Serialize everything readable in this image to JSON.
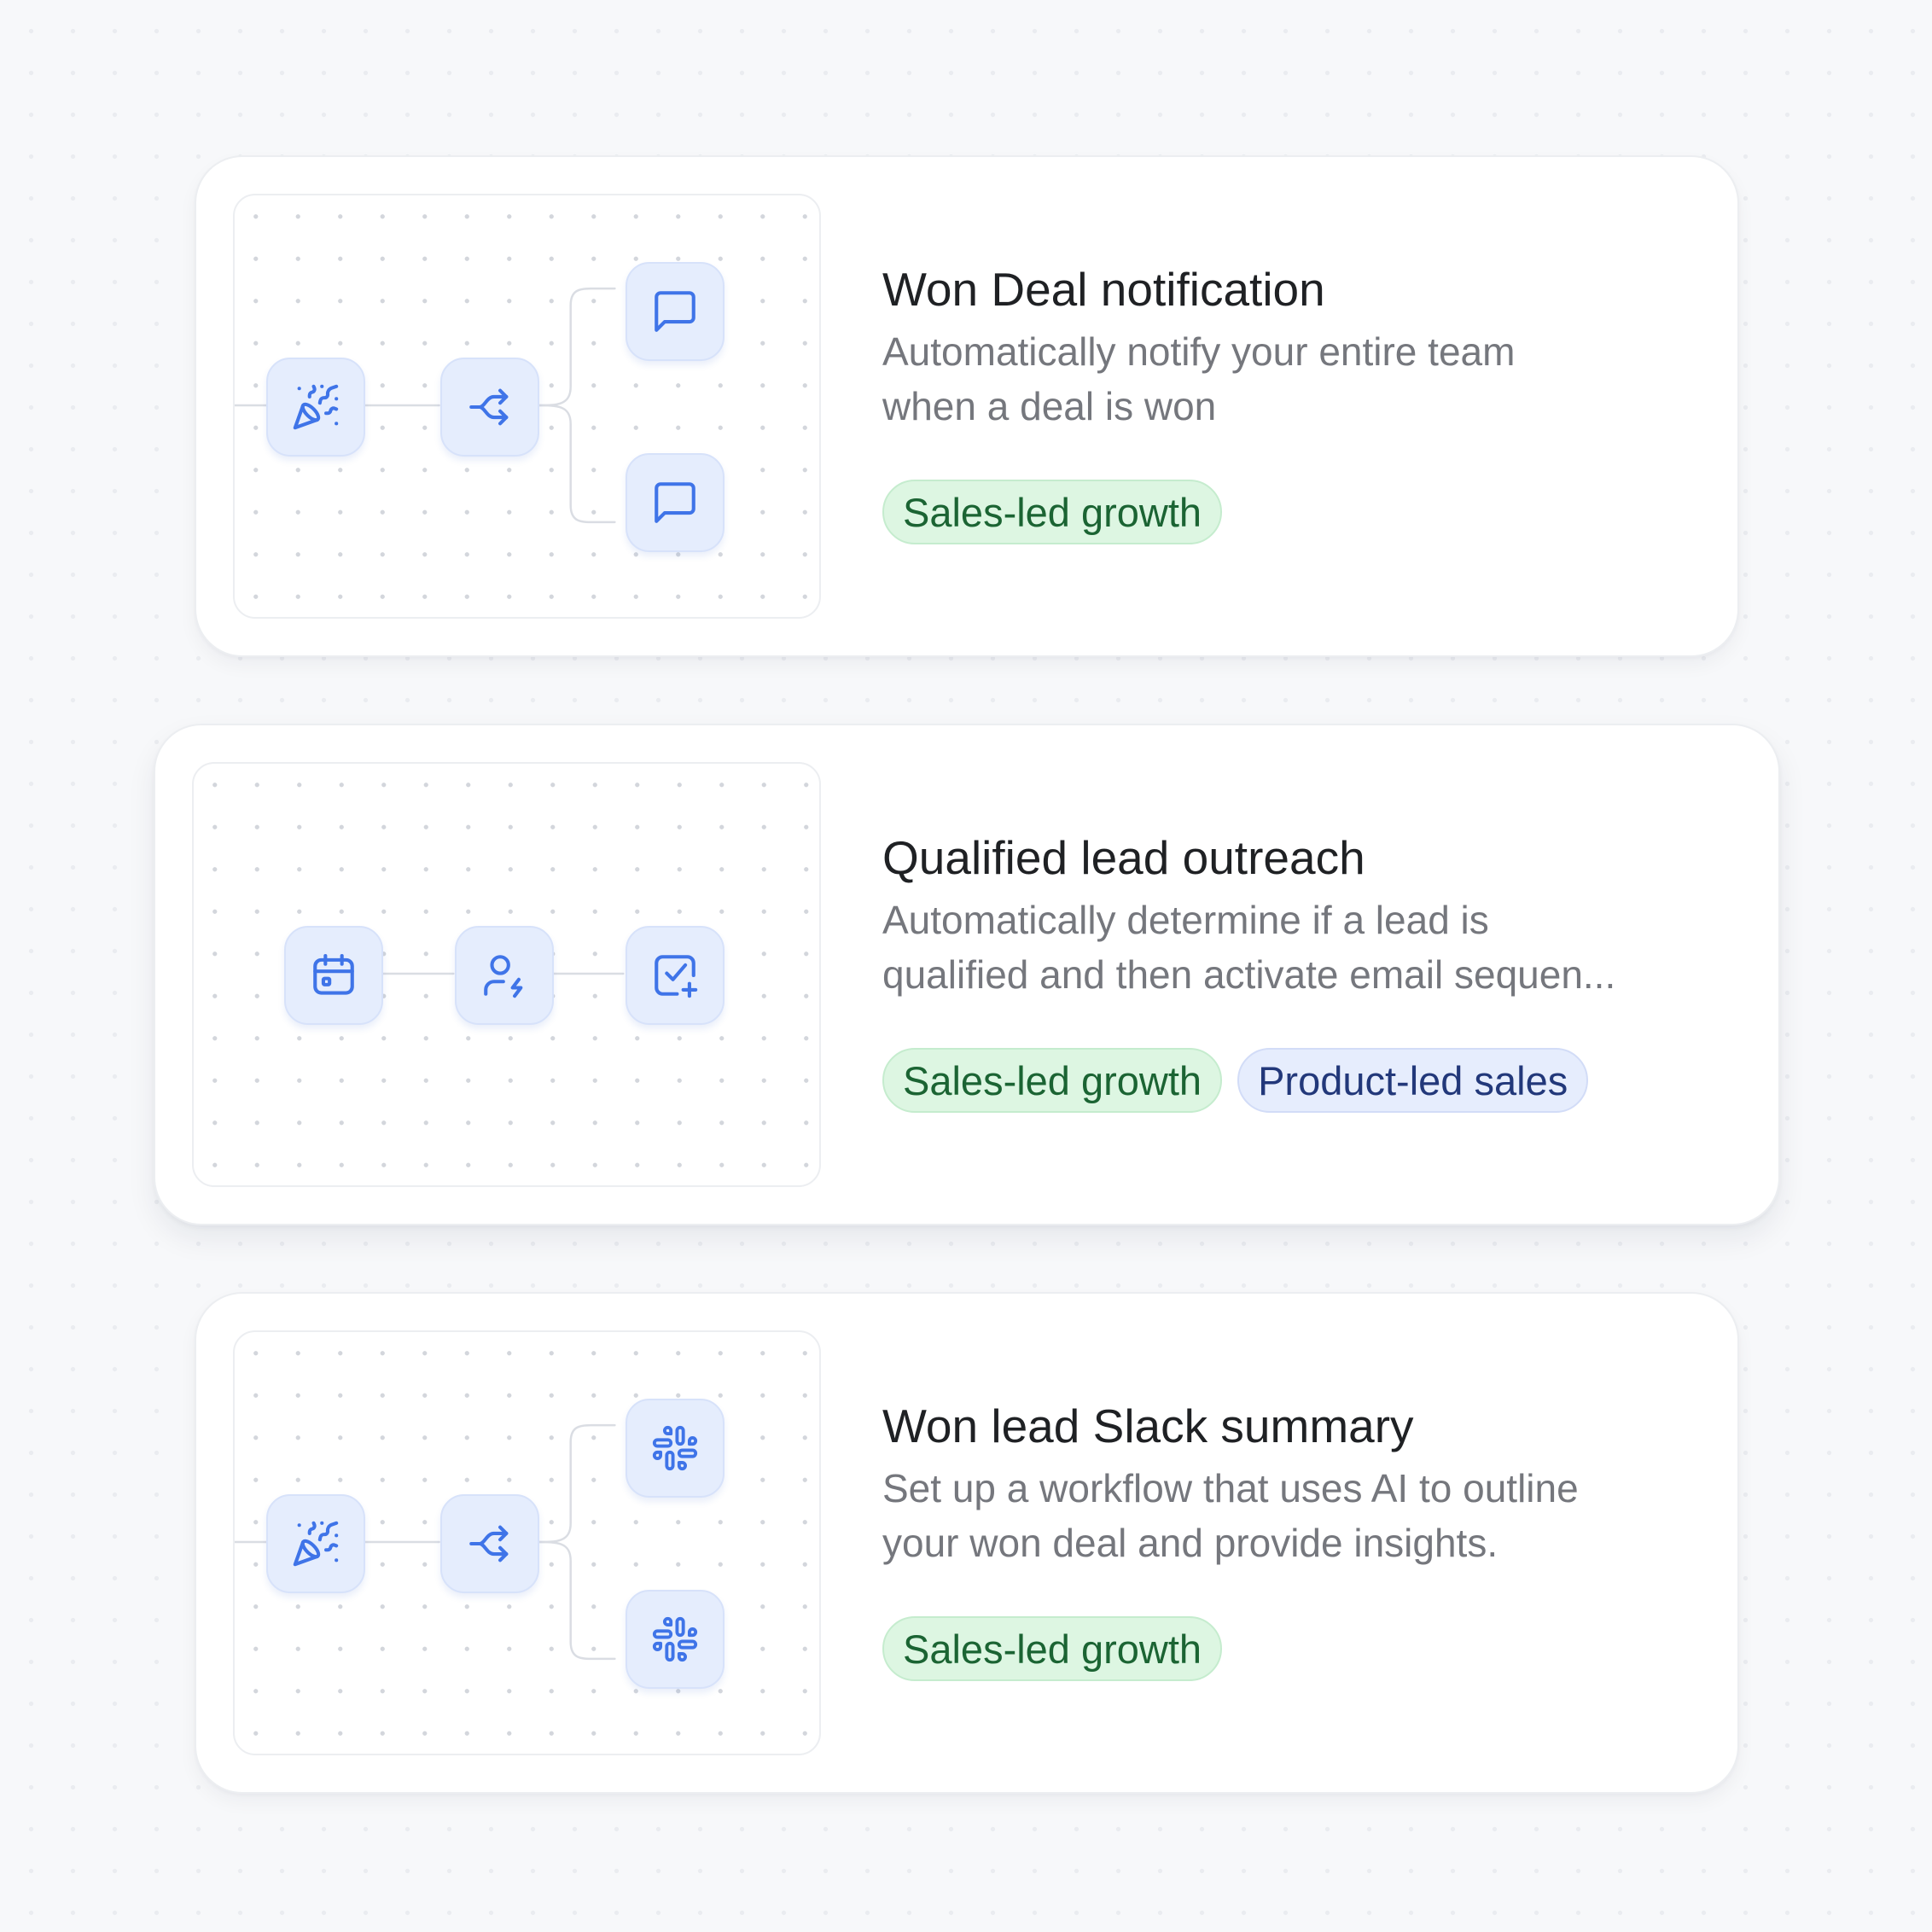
{
  "colors": {
    "background": "#f7f8fa",
    "node_fill": "#e5edfd",
    "icon_stroke": "#3f74e8",
    "tag_green_bg": "#ddf6e2",
    "tag_green_text": "#1b6433",
    "tag_blue_bg": "#e6edfd",
    "tag_blue_text": "#22387a"
  },
  "workflows": [
    {
      "title": "Won Deal notification",
      "description_lines": [
        "Automatically notify your entire team",
        "when a deal is won"
      ],
      "tags": [
        {
          "label": "Sales-led growth",
          "color": "green"
        }
      ],
      "flow_icons": [
        "party-popper-icon",
        "split-arrows-icon",
        "message-square-icon",
        "message-square-icon"
      ]
    },
    {
      "title": "Qualified lead outreach",
      "description_lines": [
        "Automatically determine if a lead is",
        "qualified and then activate email sequen..."
      ],
      "tags": [
        {
          "label": "Sales-led growth",
          "color": "green"
        },
        {
          "label": "Product-led sales",
          "color": "blue"
        }
      ],
      "flow_icons": [
        "calendar-icon",
        "user-bolt-icon",
        "square-check-plus-icon"
      ]
    },
    {
      "title": "Won lead Slack summary",
      "description_lines": [
        "Set up a workflow that uses AI to outline",
        "your won deal and provide insights."
      ],
      "tags": [
        {
          "label": "Sales-led growth",
          "color": "green"
        }
      ],
      "flow_icons": [
        "party-popper-icon",
        "split-arrows-icon",
        "slack-icon",
        "slack-icon"
      ]
    }
  ]
}
